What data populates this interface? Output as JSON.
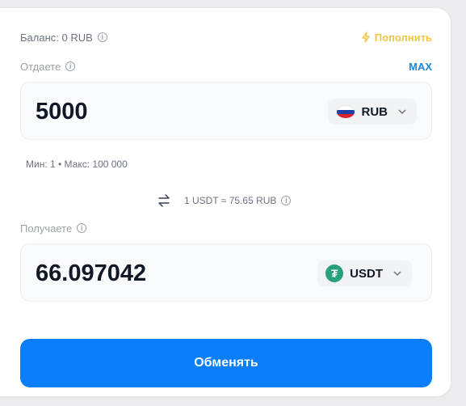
{
  "balance": {
    "label": "Баланс: 0 RUB",
    "topup_label": "Пополнить"
  },
  "give": {
    "label": "Отдаете",
    "max_label": "MAX",
    "amount": "5000",
    "currency": "RUB",
    "limits": "Мин: 1 • Макс: 100 000"
  },
  "rate": {
    "text": "1 USDT ≈ 75.65 RUB"
  },
  "receive": {
    "label": "Получаете",
    "amount": "66.097042",
    "currency": "USDT"
  },
  "action": {
    "exchange_label": "Обменять"
  },
  "colors": {
    "accent": "#0a7ef9",
    "topup": "#f4c543",
    "max": "#1d86d8",
    "tether": "#26a17b"
  },
  "icons": {
    "info": "info-icon",
    "topup": "lightning-icon",
    "swap": "swap-arrows-icon",
    "rub": "russia-flag-icon",
    "usdt": "tether-icon",
    "chevron": "chevron-down-icon"
  }
}
